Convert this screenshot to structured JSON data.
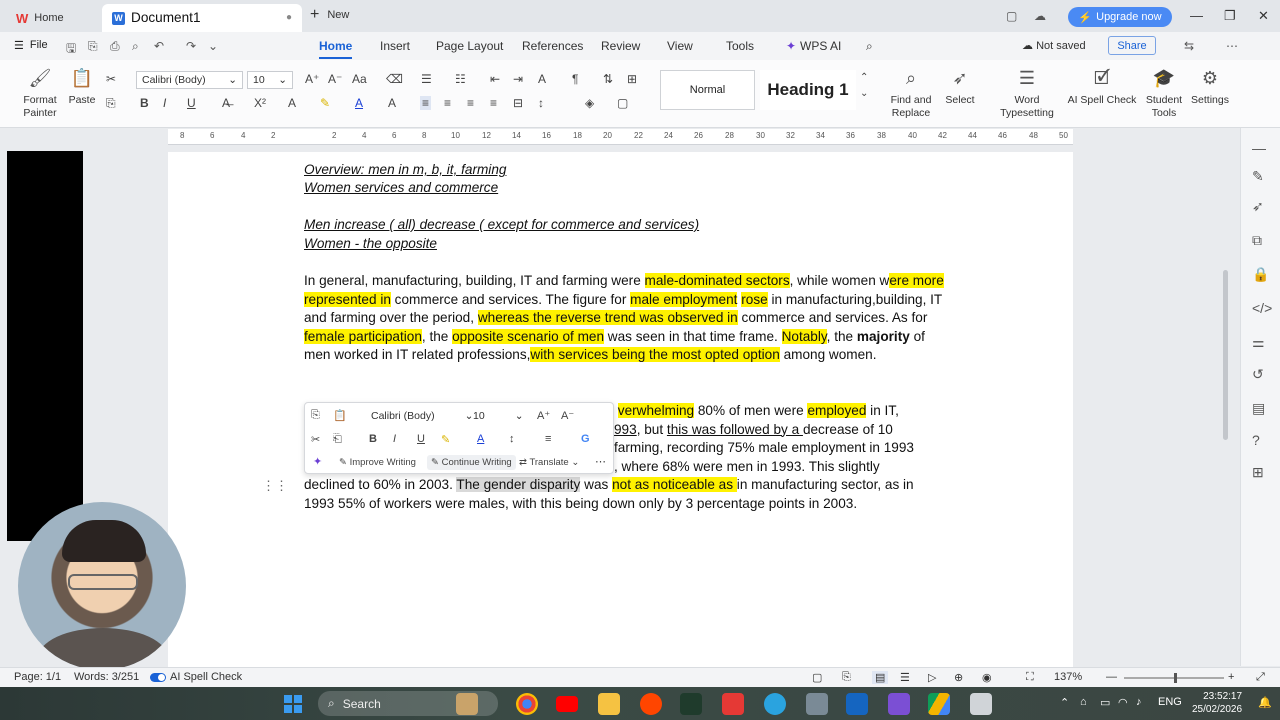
{
  "titlebar": {
    "home_tab": "Home",
    "doc_tab": "Document1",
    "new_tab": "New",
    "upgrade": "Upgrade now"
  },
  "menubar": {
    "file": "File",
    "items": [
      "Home",
      "Insert",
      "Page Layout",
      "References",
      "Review",
      "View",
      "Tools",
      "WPS AI"
    ],
    "not_saved": "Not saved",
    "share": "Share"
  },
  "ribbon": {
    "format_painter": "Format Painter",
    "paste": "Paste",
    "font_name": "Calibri (Body)",
    "font_size": "10",
    "style_normal": "Normal",
    "style_heading": "Heading 1",
    "find_replace": "Find and Replace",
    "select": "Select",
    "word_typesetting": "Word Typesetting",
    "ai_spell": "AI Spell Check",
    "student_tools": "Student Tools",
    "settings": "Settings"
  },
  "ruler": [
    "8",
    "6",
    "4",
    "2",
    "2",
    "4",
    "6",
    "8",
    "10",
    "12",
    "14",
    "16",
    "18",
    "20",
    "22",
    "24",
    "26",
    "28",
    "30",
    "32",
    "34",
    "36",
    "38",
    "40",
    "42",
    "44",
    "46",
    "48",
    "50"
  ],
  "document": {
    "line1": "Overview: men in m, b, it, farming",
    "line2": "Women services and commerce",
    "line3": "Men increase ( all) decrease ( except for commerce and services)",
    "line4": "Women - the opposite"
  },
  "floating_toolbar": {
    "font_name": "Calibri (Body)",
    "font_size": "10",
    "improve": "Improve Writing",
    "continue": "Continue Writing",
    "translate": "Translate"
  },
  "status": {
    "page": "Page: 1/1",
    "words": "Words: 3/251",
    "spell": "AI Spell Check",
    "zoom": "137%"
  },
  "taskbar": {
    "search": "Search",
    "lang": "ENG",
    "time": "23:52:17",
    "date": "25/02/2026"
  }
}
